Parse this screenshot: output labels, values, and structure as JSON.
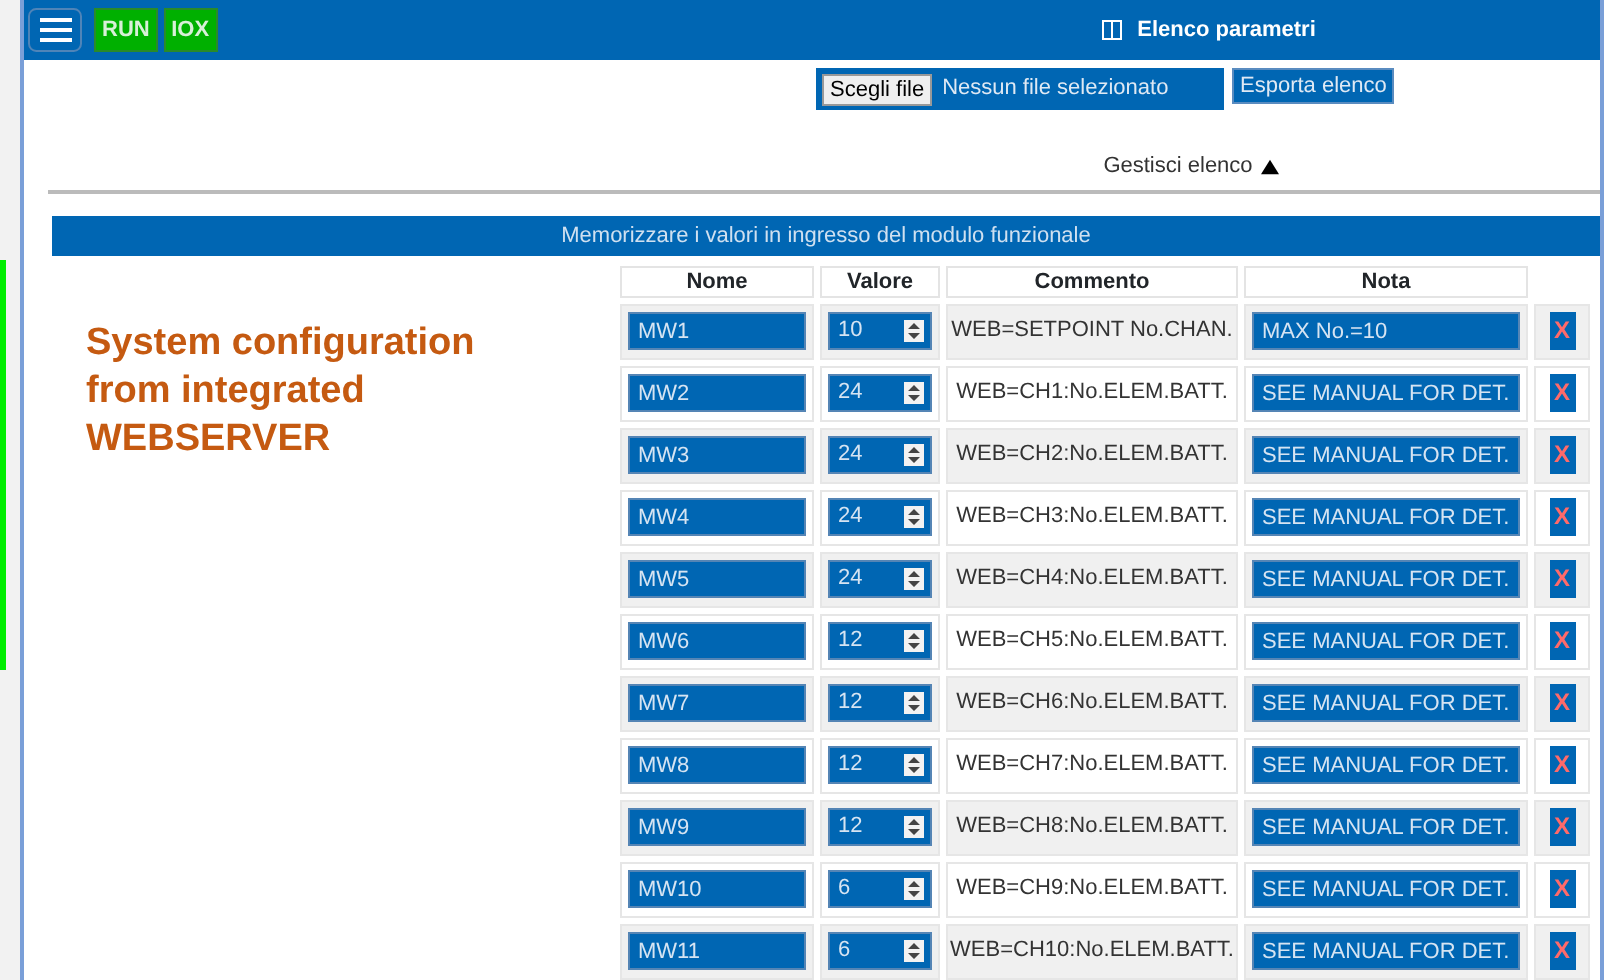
{
  "header": {
    "badges": [
      {
        "label": "RUN"
      },
      {
        "label": "IOX"
      }
    ],
    "title": "Elenco parametri"
  },
  "file_picker": {
    "button": "Scegli file",
    "status": "Nessun file selezionato"
  },
  "export_button": "Esporta elenco",
  "manage_toggle": {
    "label": "Gestisci elenco",
    "expanded": true
  },
  "banner": "Memorizzare i valori in ingresso del modulo funzionale",
  "overlay_text": "System configuration from integrated WEBSERVER",
  "table": {
    "columns": [
      "Nome",
      "Valore",
      "Commento",
      "Nota"
    ],
    "rows": [
      {
        "name": "MW1",
        "value": "10",
        "comment": "WEB=SETPOINT No.CHAN.",
        "note": "MAX No.=10",
        "delete": "X"
      },
      {
        "name": "MW2",
        "value": "24",
        "comment": "WEB=CH1:No.ELEM.BATT.",
        "note": "SEE MANUAL FOR DET.",
        "delete": "X"
      },
      {
        "name": "MW3",
        "value": "24",
        "comment": "WEB=CH2:No.ELEM.BATT.",
        "note": "SEE MANUAL FOR DET.",
        "delete": "X"
      },
      {
        "name": "MW4",
        "value": "24",
        "comment": "WEB=CH3:No.ELEM.BATT.",
        "note": "SEE MANUAL FOR DET.",
        "delete": "X"
      },
      {
        "name": "MW5",
        "value": "24",
        "comment": "WEB=CH4:No.ELEM.BATT.",
        "note": "SEE MANUAL FOR DET.",
        "delete": "X"
      },
      {
        "name": "MW6",
        "value": "12",
        "comment": "WEB=CH5:No.ELEM.BATT.",
        "note": "SEE MANUAL FOR DET.",
        "delete": "X"
      },
      {
        "name": "MW7",
        "value": "12",
        "comment": "WEB=CH6:No.ELEM.BATT.",
        "note": "SEE MANUAL FOR DET.",
        "delete": "X"
      },
      {
        "name": "MW8",
        "value": "12",
        "comment": "WEB=CH7:No.ELEM.BATT.",
        "note": "SEE MANUAL FOR DET.",
        "delete": "X"
      },
      {
        "name": "MW9",
        "value": "12",
        "comment": "WEB=CH8:No.ELEM.BATT.",
        "note": "SEE MANUAL FOR DET.",
        "delete": "X"
      },
      {
        "name": "MW10",
        "value": "6",
        "comment": "WEB=CH9:No.ELEM.BATT.",
        "note": "SEE MANUAL FOR DET.",
        "delete": "X"
      },
      {
        "name": "MW11",
        "value": "6",
        "comment": "WEB=CH10:No.ELEM.BATT.",
        "note": "SEE MANUAL FOR DET.",
        "delete": "X"
      }
    ]
  }
}
